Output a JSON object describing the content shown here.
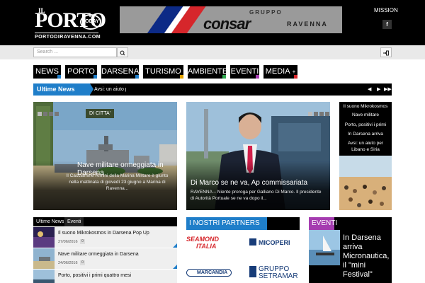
{
  "header": {
    "logo_il": "IL",
    "logo_porto": "PORTO",
    "logo_today": "TODAY",
    "logo_site": "PORTODIRAVENNA.COM",
    "banner_gruppo": "GRUPPO",
    "banner_brand": "consar",
    "banner_city": "RAVENNA",
    "mission": "MISSION",
    "fb_icon": "f"
  },
  "search": {
    "placeholder": "Search ..."
  },
  "nav": [
    {
      "label": "NEWS",
      "accent": "#1f7ec9"
    },
    {
      "label": "PORTO",
      "accent": "#1f7ec9"
    },
    {
      "label": "DARSENA",
      "accent": "#1f7ec9"
    },
    {
      "label": "TURISMO",
      "accent": "#e0a000"
    },
    {
      "label": "AMBIENTE",
      "accent": "#2fa84f"
    },
    {
      "label": "EVENTI",
      "accent": "#a53cb0"
    },
    {
      "label": "MEDIA",
      "accent": "#d6262b",
      "plus": "+"
    }
  ],
  "ticker": {
    "label": "Ultime News",
    "text": "Avsi: un aiuto p",
    "prev": "◀",
    "next": "▶",
    "ff": "▶▶"
  },
  "stories": [
    {
      "tag": "DI CITTA'",
      "title": "Nave militare ormeggiata in Darsena",
      "excerpt": "Il Cacciamine Rimini della Marina Militare è giunto nella mattinata di giovedì 23 giugno a Marina di Ravenna..."
    },
    {
      "title": "Di Marco se ne va, Ap commissariata",
      "excerpt": "RAVENNA – Niente proroga per Galliano Di Marco. Il presidente di Autorità Portuale se ne va dopo il..."
    }
  ],
  "sidebar_links": [
    "Il suono Mikrokosmos",
    "Nave militare",
    "Porto, positivi i primi",
    "In Darsena arriva",
    "Avsi: un aiuto per",
    "Libano e Siria"
  ],
  "latest": {
    "tab_active": "Ultime News",
    "tab_inactive": "Eventi",
    "items": [
      {
        "title": "Il suono Mikrokosmos in Darsena Pop Up",
        "date": "27/06/2016",
        "count": "0"
      },
      {
        "title": "Nave militare ormeggiata in Darsena",
        "date": "24/06/2016",
        "count": "0"
      },
      {
        "title": "Porto, positivi i primi quattro mesi",
        "date": "",
        "count": ""
      }
    ]
  },
  "partners": {
    "label": "I NOSTRI PARTNERS",
    "seamond_1": "SEAMOND",
    "seamond_2": "ITALIA",
    "micoperi": "MICOPERI",
    "marcandia": "MARCANDIA",
    "setramar_1": "GRUPPO",
    "setramar_2": "SETRAMAR"
  },
  "eventi": {
    "label": "EVENTI",
    "title": "In Darsena arriva Micronautica, il \"mini Festival\""
  }
}
